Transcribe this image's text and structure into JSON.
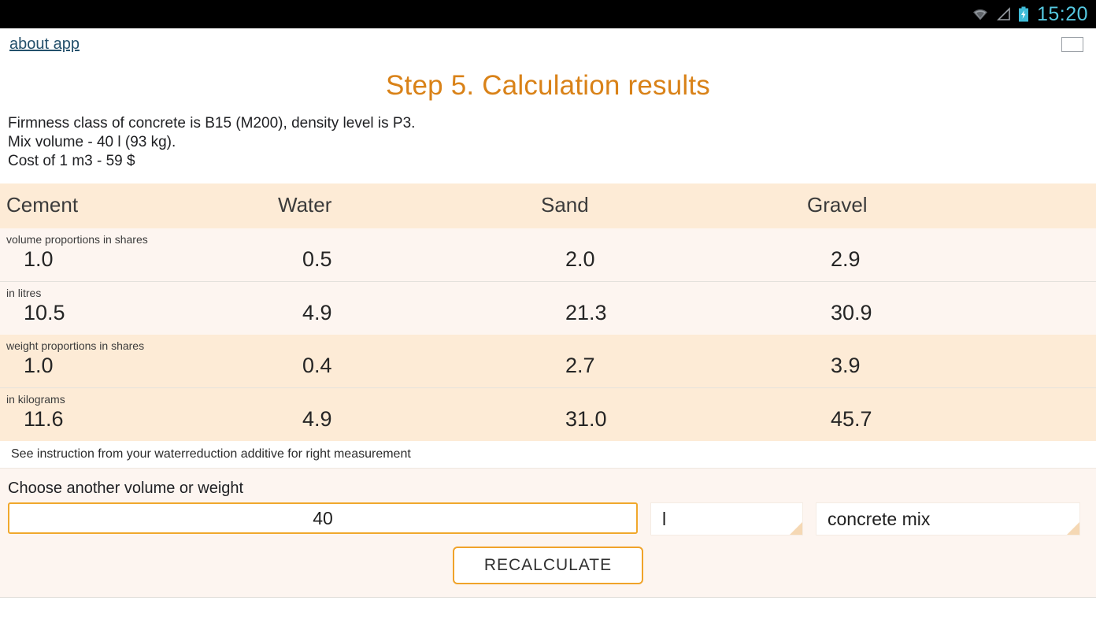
{
  "statusbar": {
    "time": "15:20",
    "icons": [
      "wifi-icon",
      "signal-icon",
      "battery-charging-icon"
    ],
    "clock_color": "#55c8e0"
  },
  "topbar": {
    "about_label": "about app",
    "language_flag": "russia-flag-icon"
  },
  "header": {
    "title": "Step 5. Calculation results",
    "title_color": "#d98218"
  },
  "description": {
    "line1": "Firmness class of concrete is B15 (M200), density level is P3.",
    "line2": "Mix volume - 40 l (93 kg).",
    "line3": "Cost of 1 m3 - 59 $"
  },
  "table": {
    "columns": [
      "Cement",
      "Water",
      "Sand",
      "Gravel"
    ],
    "rows": [
      {
        "label": "volume proportions in shares",
        "values": [
          "1.0",
          "0.5",
          "2.0",
          "2.9"
        ]
      },
      {
        "label": "in litres",
        "values": [
          "10.5",
          "4.9",
          "21.3",
          "30.9"
        ]
      },
      {
        "label": "weight proportions in shares",
        "values": [
          "1.0",
          "0.4",
          "2.7",
          "3.9"
        ]
      },
      {
        "label": "in kilograms",
        "values": [
          "11.6",
          "4.9",
          "31.0",
          "45.7"
        ]
      }
    ]
  },
  "note": "See instruction from your waterreduction additive for right measurement",
  "form": {
    "label": "Choose another volume or weight",
    "amount_value": "40",
    "amount_placeholder": "40",
    "unit_value": "l",
    "material_value": "concrete mix",
    "recalculate_label": "RECALCULATE"
  },
  "colors": {
    "accent": "#f0a32a",
    "title": "#d98218",
    "row_peach": "#fdebd6",
    "row_cream": "#fdf5f0",
    "link": "#24506b"
  }
}
